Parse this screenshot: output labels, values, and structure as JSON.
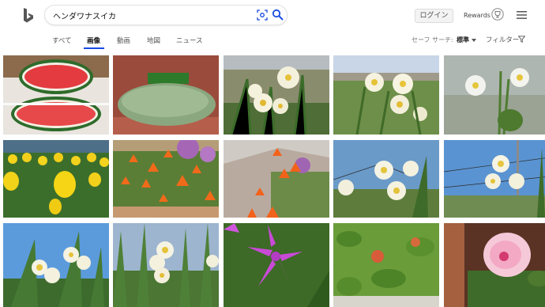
{
  "search": {
    "query": "ヘンダワナスイカ"
  },
  "header": {
    "login_label": "ログイン",
    "rewards_label": "Rewards"
  },
  "tabs": [
    {
      "label": "すべて"
    },
    {
      "label": "画像"
    },
    {
      "label": "動画"
    },
    {
      "label": "地図"
    },
    {
      "label": "ニュース"
    }
  ],
  "active_tab": "画像",
  "filters": {
    "safe_search_label": "セーフ サーチ:",
    "safe_search_value": "標準",
    "filter_label": "フィルター"
  },
  "icons": {
    "logo": "bing-logo",
    "visual_search": "visual-search-icon",
    "search": "search-icon",
    "rewards": "rewards-trophy-icon",
    "menu": "hamburger-menu-icon",
    "filter": "filter-funnel-icon",
    "safe_chev": "chevron-down-icon"
  },
  "colors": {
    "accent": "#174ae4",
    "bing_teal": "#138a8a"
  },
  "results": [
    {
      "subject": "sliced watermelon with ruler"
    },
    {
      "subject": "whole long green watermelon"
    },
    {
      "subject": "white daffodils by wall"
    },
    {
      "subject": "white daffodils in field"
    },
    {
      "subject": "white daffodils close-up"
    },
    {
      "subject": "yellow tulips flower bed"
    },
    {
      "subject": "orange tulips and purple flowers"
    },
    {
      "subject": "orange tulips by stone path"
    },
    {
      "subject": "white daffodils blue sky"
    },
    {
      "subject": "white daffodils blue sky and wires"
    },
    {
      "subject": "white daffodils with tall leaves"
    },
    {
      "subject": "white daffodils with sky"
    },
    {
      "subject": "pink orchid flower"
    },
    {
      "subject": "green plant with red fruits"
    },
    {
      "subject": "pink hibiscus flower"
    }
  ]
}
